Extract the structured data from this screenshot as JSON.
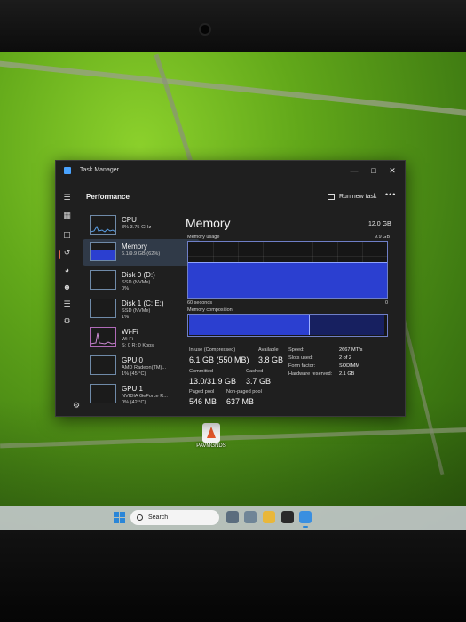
{
  "window": {
    "title": "Task Manager"
  },
  "header": {
    "title": "Performance",
    "run_task": "Run new task",
    "more": "•••"
  },
  "nav_icons": [
    "hamburger-icon",
    "processes-icon",
    "performance-icon",
    "app-history-icon",
    "startup-apps-icon",
    "users-icon",
    "details-icon",
    "services-icon",
    "settings-icon"
  ],
  "devices": [
    {
      "name": "CPU",
      "sub1": "3% 3.75 GHz",
      "sub2": "",
      "selected": false
    },
    {
      "name": "Memory",
      "sub1": "6.1/9.9 GB (62%)",
      "sub2": "",
      "selected": true
    },
    {
      "name": "Disk 0 (D:)",
      "sub1": "SSD (NVMe)",
      "sub2": "0%",
      "selected": false
    },
    {
      "name": "Disk 1 (C: E:)",
      "sub1": "SSD (NVMe)",
      "sub2": "1%",
      "selected": false
    },
    {
      "name": "Wi-Fi",
      "sub1": "Wi-Fi",
      "sub2": "S: 0 R: 0 Kbps",
      "selected": false
    },
    {
      "name": "GPU 0",
      "sub1": "AMD Radeon(TM)...",
      "sub2": "1% (45 °C)",
      "selected": false
    },
    {
      "name": "GPU 1",
      "sub1": "NVIDIA GeForce R...",
      "sub2": "0% (42 °C)",
      "selected": false
    }
  ],
  "memory": {
    "title": "Memory",
    "total": "12.0 GB",
    "usage_label": "Memory usage",
    "usage_max": "9.9 GB",
    "usage_fraction": 0.62,
    "time_label": "60 seconds",
    "axis_min": "0",
    "composition_label": "Memory composition",
    "composition_inuse_fraction": 0.61,
    "composition_standby_fraction": 0.38,
    "stats": {
      "in_use_label": "In use (Compressed)",
      "in_use_value": "6.1 GB (550 MB)",
      "available_label": "Available",
      "available_value": "3.8 GB",
      "committed_label": "Committed",
      "committed_value": "13.0/31.9 GB",
      "cached_label": "Cached",
      "cached_value": "3.7 GB",
      "paged_label": "Paged pool",
      "paged_value": "546 MB",
      "nonpaged_label": "Non-paged pool",
      "nonpaged_value": "637 MB"
    },
    "specs": [
      {
        "label": "Speed:",
        "value": "2667 MT/s"
      },
      {
        "label": "Slots used:",
        "value": "2 of 2"
      },
      {
        "label": "Form factor:",
        "value": "SODIMM"
      },
      {
        "label": "Hardware reserved:",
        "value": "2.1 GB"
      }
    ]
  },
  "desktop": {
    "icon_label": "PAVMGNDS"
  },
  "taskbar": {
    "search_placeholder": "Search"
  },
  "colors": {
    "accent": "#2b3fd0",
    "window_bg": "#1f1f1f",
    "selected_row": "#303a48"
  }
}
